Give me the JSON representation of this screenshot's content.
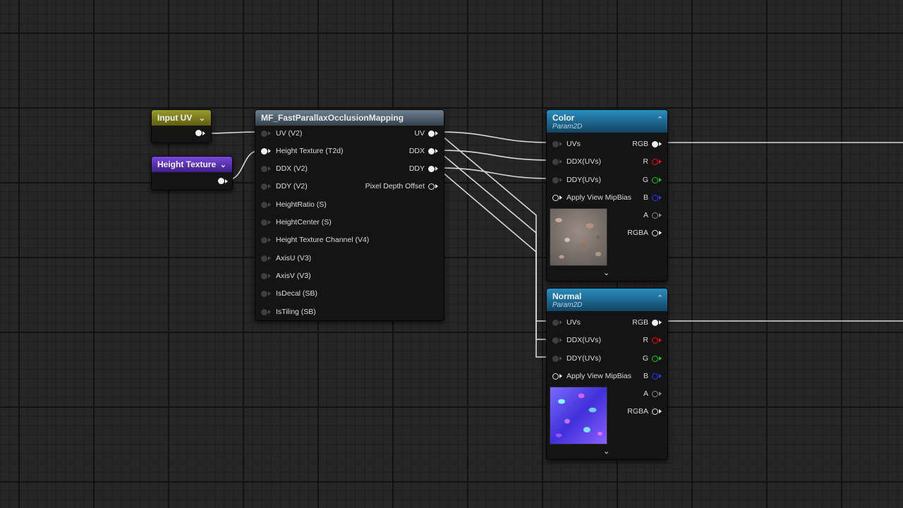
{
  "input_uv": {
    "title": "Input UV"
  },
  "height_texture": {
    "title": "Height Texture"
  },
  "function_node": {
    "title": "MF_FastParallaxOcclusionMapping",
    "inputs": [
      "UV (V2)",
      "Height Texture (T2d)",
      "DDX (V2)",
      "DDY (V2)",
      "HeightRatio (S)",
      "HeightCenter (S)",
      "Height Texture Channel (V4)",
      "AxisU (V3)",
      "AxisV (V3)",
      "IsDecal (SB)",
      "IsTiling (SB)"
    ],
    "outputs": [
      "UV",
      "DDX",
      "DDY",
      "Pixel Depth Offset"
    ]
  },
  "color_node": {
    "title": "Color",
    "subtitle": "Param2D",
    "inputs": [
      "UVs",
      "DDX(UVs)",
      "DDY(UVs)",
      "Apply View MipBias"
    ],
    "outputs": [
      "RGB",
      "R",
      "G",
      "B",
      "A",
      "RGBA"
    ],
    "preview": "stone-texture"
  },
  "normal_node": {
    "title": "Normal",
    "subtitle": "Param2D",
    "inputs": [
      "UVs",
      "DDX(UVs)",
      "DDY(UVs)",
      "Apply View MipBias"
    ],
    "outputs": [
      "RGB",
      "R",
      "G",
      "B",
      "A",
      "RGBA"
    ],
    "preview": "normal-map-texture"
  },
  "colors": {
    "canvas": "#262626",
    "wire": "#d8d8d8",
    "param_header": "#2a8ec0",
    "input_uv_header": "#9a9a2e",
    "height_texture_header": "#7a48dc",
    "pin_r": "#ee1111",
    "pin_g": "#1ec81e",
    "pin_b": "#2a3cf0"
  },
  "icons": {
    "collapse": "chevron-up-icon",
    "expand": "chevron-down-icon",
    "dropdown": "chevron-down-icon"
  }
}
